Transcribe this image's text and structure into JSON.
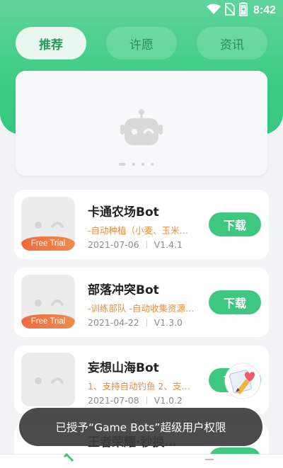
{
  "status_bar": {
    "time": "8:42"
  },
  "tabs": [
    {
      "label": "推荐",
      "active": true
    },
    {
      "label": "许愿",
      "active": false
    },
    {
      "label": "资讯",
      "active": false
    }
  ],
  "banner": {
    "page_count": 4,
    "active_index": 0
  },
  "apps": [
    {
      "title": "卡通农场Bot",
      "desc": "-自动种植（小麦、玉米…",
      "date": "2021-07-06",
      "version": "V1.4.1",
      "badge": "Free Trial",
      "button": "下载"
    },
    {
      "title": "部落冲突Bot",
      "desc": "-训练部队 -自动收集资源…",
      "date": "2021-04-22",
      "version": "V1.3.0",
      "badge": "Free Trial",
      "button": "下载"
    },
    {
      "title": "妄想山海Bot",
      "desc": "1、支持自动钓鱼 2、支…",
      "date": "2021-07-08",
      "version": "V1.0.2",
      "badge": "",
      "button": "下载"
    },
    {
      "title": "王者荣耀·秒换…",
      "desc": "",
      "date": "",
      "version": "",
      "badge": "",
      "button": ""
    }
  ],
  "toast": {
    "text": "已授予“Game Bots”超级用户权限"
  },
  "colors": {
    "brand_green": "#3ec77e",
    "trial_orange": "#f06a40",
    "desc_orange": "#f08a3c"
  }
}
